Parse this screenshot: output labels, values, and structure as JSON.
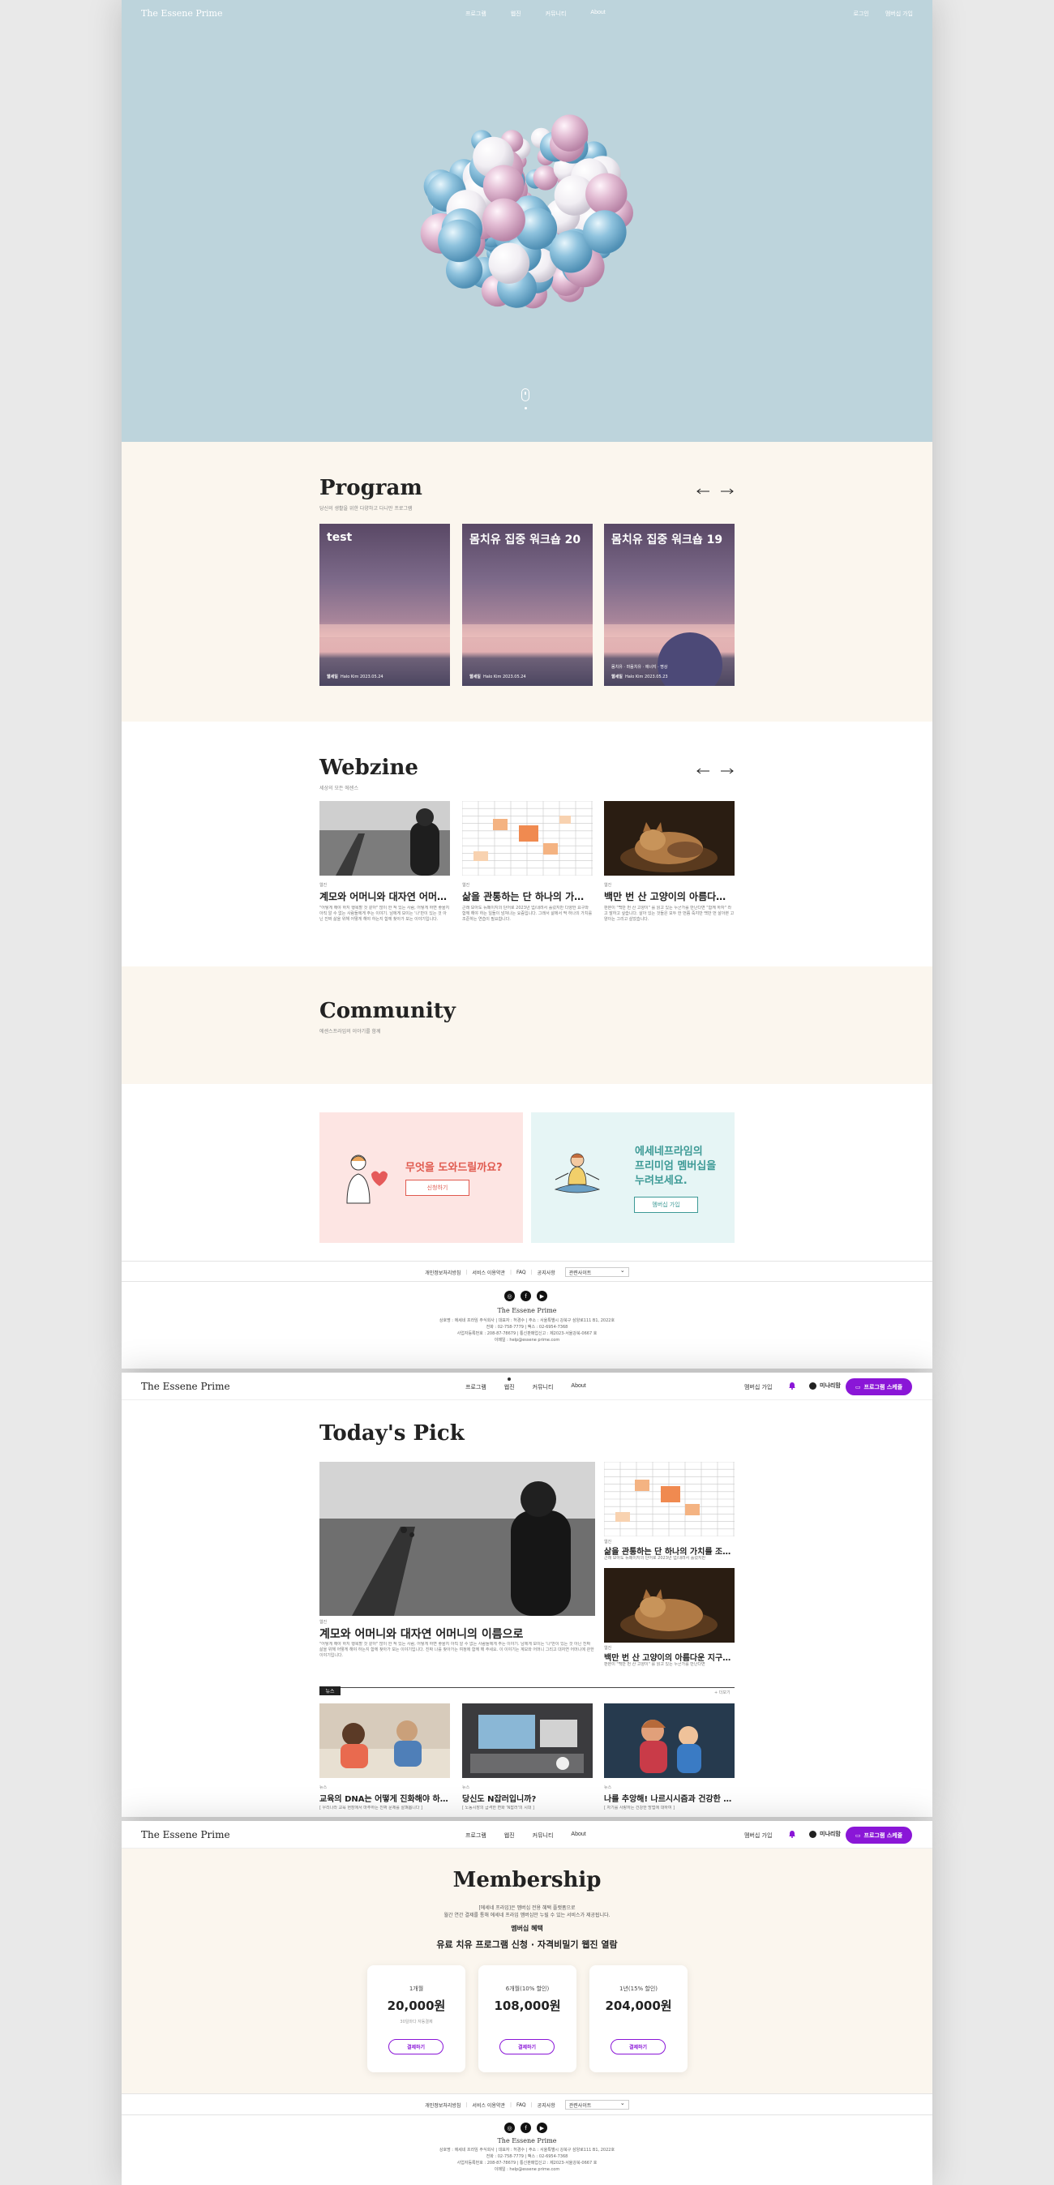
{
  "brand": "The Essene Prime",
  "hero_nav": {
    "menu": [
      "프로그램",
      "웹진",
      "커뮤니티",
      "About"
    ],
    "login": "로그인",
    "join": "멤버십 가입"
  },
  "program": {
    "title": "Program",
    "subtitle": "당신의 생활을 위한 다양하고 다니만 프로그램",
    "cards": [
      {
        "title": "test",
        "tag": "웹세일",
        "meta": "Halo Kim 2023.05.24",
        "extra": ""
      },
      {
        "title": "몸치유 집중 워크숍 20",
        "tag": "웹세일",
        "meta": "Halo Kim 2023.05.24",
        "extra": ""
      },
      {
        "title": "몸치유 집중 워크숍 19",
        "tag": "웹세일",
        "meta": "Halo Kim 2023.05.23",
        "extra": "몸치유 · 마음치유 · 에너지 · 명상"
      }
    ]
  },
  "webzine": {
    "title": "Webzine",
    "subtitle": "세상의 모든 에센스",
    "cards": [
      {
        "cat": "웹진",
        "title": "계모와 어머니와 대자연 어머니의 이름으로",
        "text": "\"어떻게 해야 하지 행복할 것 같아\" 많이 한 적 있는 사람, 어떻게 하면 좋을지 아직 알 수 없는 사람들에게 주는 이야기. 남에게 보이는 '나'만이 있는 것 아닌 진짜 삶을 위해 어떻게 해야 하는지 함께 찾아가 보는 이야기입니다."
      },
      {
        "cat": "웹진",
        "title": "삶을 관통하는 단 하나의 가치를 조준하라",
        "text": "근래 보아도 뉴페이지의 단어로 2023년 업/내려서 흘렀지만 다양한 요구와 함께 해야 하는 일들이 넘쳐나는 요즘입니다. 그래서 삶에서 딱 하나의 가치를 조준하는 연습이 필요합니다."
      },
      {
        "cat": "웹진",
        "title": "백만 번 산 고양이의 아름다운 지구 별 여행",
        "text": "판본이 \"백만 번 산 고양이\" 를 읽고 있는 누군가를 만난다면 \"함께 하자\" 라고 말하고 싶습니다. 살아 있는 것들은 모두 한 번쯤 죽지만 백만 번 살아본 고양이는 그리고 살았습니다."
      }
    ]
  },
  "community": {
    "title": "Community",
    "subtitle": "에센스프라임의 이야기를 함께"
  },
  "banners": {
    "help": {
      "title": "무엇을 도와드릴까요?",
      "button": "신청하기"
    },
    "premium": {
      "title_lines": [
        "에세네프라임의",
        "프리미엄 멤버십을",
        "누려보세요."
      ],
      "button": "멤버십 가입"
    }
  },
  "footer": {
    "links": [
      "개인정보처리방침",
      "서비스 이용약관",
      "FAQ",
      "공지사항"
    ],
    "select": "관련사이트",
    "brand": "The Essene Prime",
    "info": [
      "상호명 : 에세네 프라임 주식회사 | 대표자 : 허경수 | 주소 : 서울특별시 강북구 삼양로111 B1, 2022호",
      "전화 : 02-758-7779 | 팩스 : 02-6954-7368",
      "사업자등록번호 : 208-87-78679 | 통신판매업신고 : 제2023-서울강북-0667 호",
      "이메일 : help@essene prime.com"
    ]
  },
  "header": {
    "menu": [
      "프로그램",
      "웹진",
      "커뮤니티",
      "About"
    ],
    "active": "웹진",
    "membership": "멤버십 가입",
    "user": "미나리맘",
    "schedule_button": "프로그램 스케줄"
  },
  "todays_pick": {
    "title": "Today's Pick",
    "main": {
      "cat": "웹진",
      "title": "계모와 어머니와 대자연 어머니의 이름으로",
      "text": "\"어떻게 해야 하지 행복할 것 같아\" 많이 한 적 있는 사람, 어떻게 하면 좋을지 아직 알 수 없는 사람들에게 주는 이야기. 남에게 보이는 '나'만이 있는 것 아닌 진짜 삶을 위해 어떻게 해야 하는지 함께 찾아가 보는 이야기입니다. 진짜 나를 찾아가는 여정에 함께 해 주세요. 이 이야기는 계모와 어머니 그리고 대자연 어머니에 관한 이야기입니다."
    },
    "side": [
      {
        "cat": "웹진",
        "title": "삶을 관통하는 단 하나의 가치를 조준하라",
        "text": "근래 보아도 뉴페이지의 단어로 2023년 업/내려서 흘렀지만"
      },
      {
        "cat": "웹진",
        "title": "백만 번 산 고양이의 아름다운 지구별 여행",
        "text": "판본이 \"백만 번 산 고양이\" 를 읽고 있는 누군가를 만난다면"
      }
    ],
    "news_tag": "뉴스",
    "news_more": "+ 더보기",
    "news": [
      {
        "cat": "뉴스",
        "title": "교육의 DNA는 어떻게 진화해야 하는가",
        "text": "[ 우리나라 교육 현장에서 마주하는 진짜 문제를 살펴봅니다 ]"
      },
      {
        "cat": "뉴스",
        "title": "당신도 N잡러입니까?",
        "text": "[ 노동시장의 급격한 변화 'N잡러'의 시대 ]"
      },
      {
        "cat": "뉴스",
        "title": "나를 추앙해! 나르시시즘과 건강한 자기애",
        "text": "[ 자기를 사랑하는 건강한 방법에 대하여 ]"
      }
    ]
  },
  "membership": {
    "title": "Membership",
    "desc1": "[에세네 프라임]은 멤버십 전용 혜택 플랫폼으로",
    "desc2": "월간 연간 결제를 통해 에세네 프라임 멤버십만 누릴 수 있는 서비스가 제공됩니다.",
    "benefit_label": "멤버십 혜택",
    "benefit": "유료 치유 프로그램 신청 · 자격비밀기 웹진 열람",
    "plans": [
      {
        "name": "1개월",
        "price": "20,000원",
        "note": "30일마다 자동결제",
        "button": "결제하기"
      },
      {
        "name": "6개월(10% 할인)",
        "price": "108,000원",
        "note": "",
        "button": "결제하기"
      },
      {
        "name": "1년(15% 할인)",
        "price": "204,000원",
        "note": "",
        "button": "결제하기"
      }
    ]
  }
}
